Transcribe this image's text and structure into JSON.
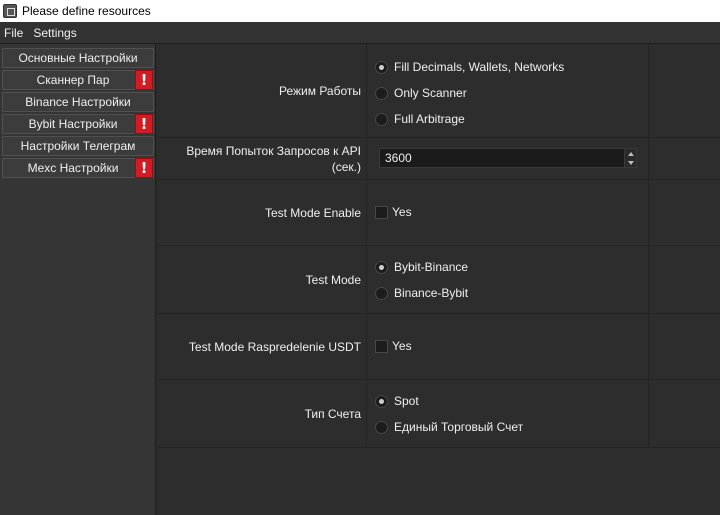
{
  "window": {
    "title": "Please define resources"
  },
  "menu": {
    "file": "File",
    "settings": "Settings"
  },
  "sidebar": {
    "items": [
      {
        "label": "Основные Настройки",
        "warning": false
      },
      {
        "label": "Сканнер Пар",
        "warning": true
      },
      {
        "label": "Binance Настройки",
        "warning": false
      },
      {
        "label": "Bybit Настройки",
        "warning": true
      },
      {
        "label": "Настройки Телеграм",
        "warning": false
      },
      {
        "label": "Mexc Настройки",
        "warning": true
      }
    ],
    "warning_glyph": "!"
  },
  "settings": {
    "mode": {
      "label": "Режим Работы",
      "options": [
        "Fill Decimals, Wallets, Networks",
        "Only Scanner",
        "Full Arbitrage"
      ],
      "selected": "Fill Decimals, Wallets, Networks"
    },
    "api_time": {
      "label": "Время Попыток Запросов к API (сек.)",
      "value": "3600"
    },
    "test_mode_enable": {
      "label": "Test Mode Enable",
      "checkbox_label": "Yes",
      "checked": false
    },
    "test_mode": {
      "label": "Test Mode",
      "options": [
        "Bybit-Binance",
        "Binance-Bybit"
      ],
      "selected": "Bybit-Binance"
    },
    "test_mode_usdt": {
      "label": "Test Mode Raspredelenie USDT",
      "checkbox_label": "Yes",
      "checked": false
    },
    "account_type": {
      "label": "Тип Счета",
      "options": [
        "Spot",
        "Единый Торговый Счет"
      ],
      "selected": "Spot"
    }
  },
  "icons": {
    "app": "app-icon",
    "warning": "warning-icon",
    "spin_up": "arrow-up-icon",
    "spin_down": "arrow-down-icon"
  },
  "colors": {
    "warning": "#d01c22",
    "background": "#2d2d2d",
    "sidebar": "#353535"
  }
}
